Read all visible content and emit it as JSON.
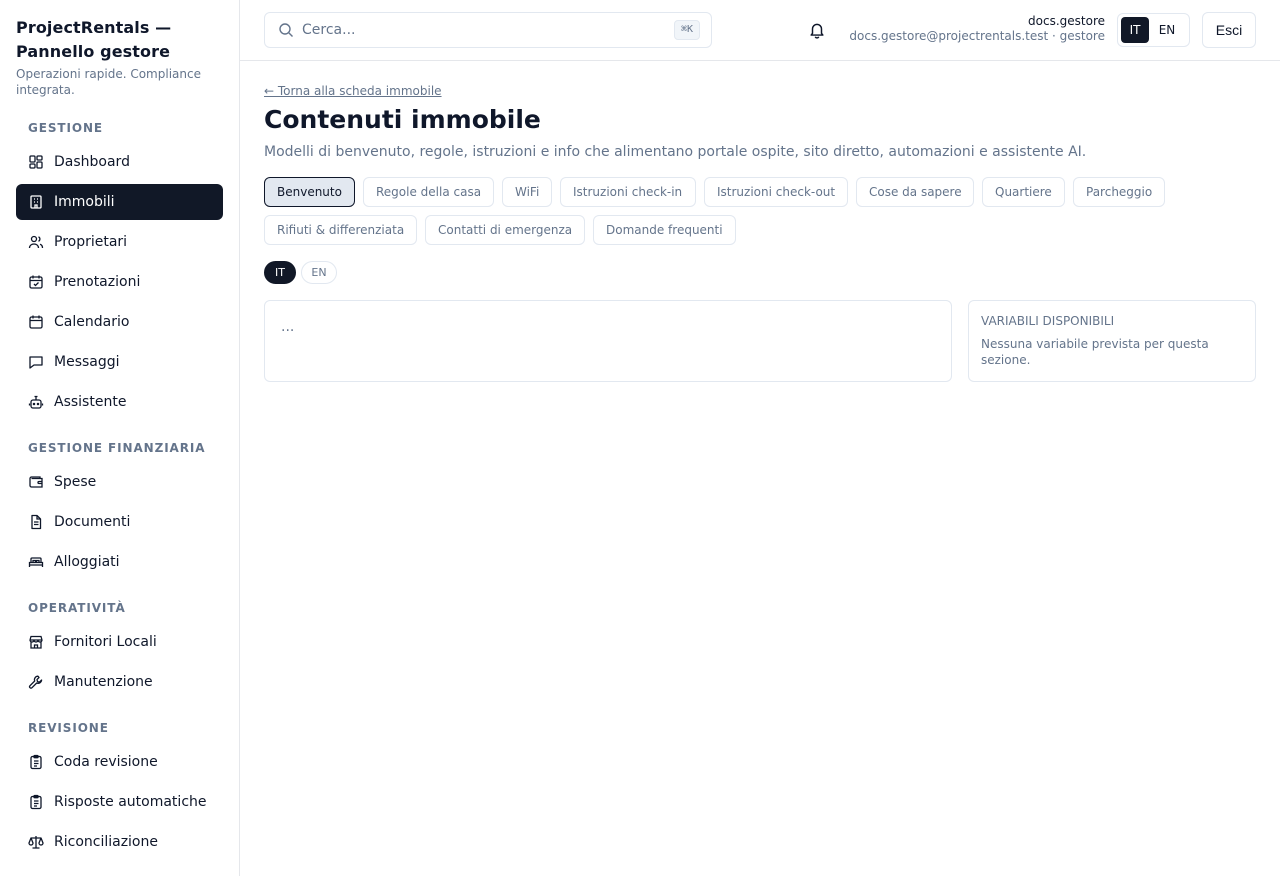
{
  "brand": {
    "title": "ProjectRentals — Pannello gestore",
    "subtitle": "Operazioni rapide. Compliance integrata."
  },
  "sidebar": {
    "sections": [
      {
        "label": "GESTIONE",
        "items": [
          {
            "label": "Dashboard",
            "icon": "dashboard-icon",
            "active": false
          },
          {
            "label": "Immobili",
            "icon": "building-icon",
            "active": true
          },
          {
            "label": "Proprietari",
            "icon": "users-icon",
            "active": false
          },
          {
            "label": "Prenotazioni",
            "icon": "calendar-check-icon",
            "active": false
          },
          {
            "label": "Calendario",
            "icon": "calendar-icon",
            "active": false
          },
          {
            "label": "Messaggi",
            "icon": "message-icon",
            "active": false
          },
          {
            "label": "Assistente",
            "icon": "bot-icon",
            "active": false
          }
        ]
      },
      {
        "label": "GESTIONE FINANZIARIA",
        "items": [
          {
            "label": "Spese",
            "icon": "wallet-icon",
            "active": false
          },
          {
            "label": "Documenti",
            "icon": "document-icon",
            "active": false
          },
          {
            "label": "Alloggiati",
            "icon": "bed-icon",
            "active": false
          }
        ]
      },
      {
        "label": "OPERATIVITÀ",
        "items": [
          {
            "label": "Fornitori Locali",
            "icon": "store-icon",
            "active": false
          },
          {
            "label": "Manutenzione",
            "icon": "wrench-icon",
            "active": false
          }
        ]
      },
      {
        "label": "REVISIONE",
        "items": [
          {
            "label": "Coda revisione",
            "icon": "clipboard-list-icon",
            "active": false
          },
          {
            "label": "Risposte automatiche",
            "icon": "clipboard-check-icon",
            "active": false
          },
          {
            "label": "Riconciliazione",
            "icon": "scale-icon",
            "active": false
          }
        ]
      }
    ]
  },
  "topbar": {
    "search_placeholder": "Cerca...",
    "search_shortcut": "⌘K",
    "user_name": "docs.gestore",
    "user_detail": "docs.gestore@projectrentals.test · gestore",
    "lang_it": "IT",
    "lang_en": "EN",
    "logout_label": "Esci"
  },
  "main": {
    "back_link": "← Torna alla scheda immobile",
    "title": "Contenuti immobile",
    "description": "Modelli di benvenuto, regole, istruzioni e info che alimentano portale ospite, sito diretto, automazioni e assistente AI.",
    "tabs": [
      "Benvenuto",
      "Regole della casa",
      "WiFi",
      "Istruzioni check-in",
      "Istruzioni check-out",
      "Cose da sapere",
      "Quartiere",
      "Parcheggio",
      "Rifiuti & differenziata",
      "Contatti di emergenza",
      "Domande frequenti"
    ],
    "active_tab": "Benvenuto",
    "content_lang_it": "IT",
    "content_lang_en": "EN",
    "editor_text": "...",
    "vars_title": "VARIABILI DISPONIBILI",
    "vars_text": "Nessuna variabile prevista per questa sezione."
  },
  "colors": {
    "accent": "#111827",
    "border": "#e2e8f0",
    "muted_text": "#64748b"
  }
}
